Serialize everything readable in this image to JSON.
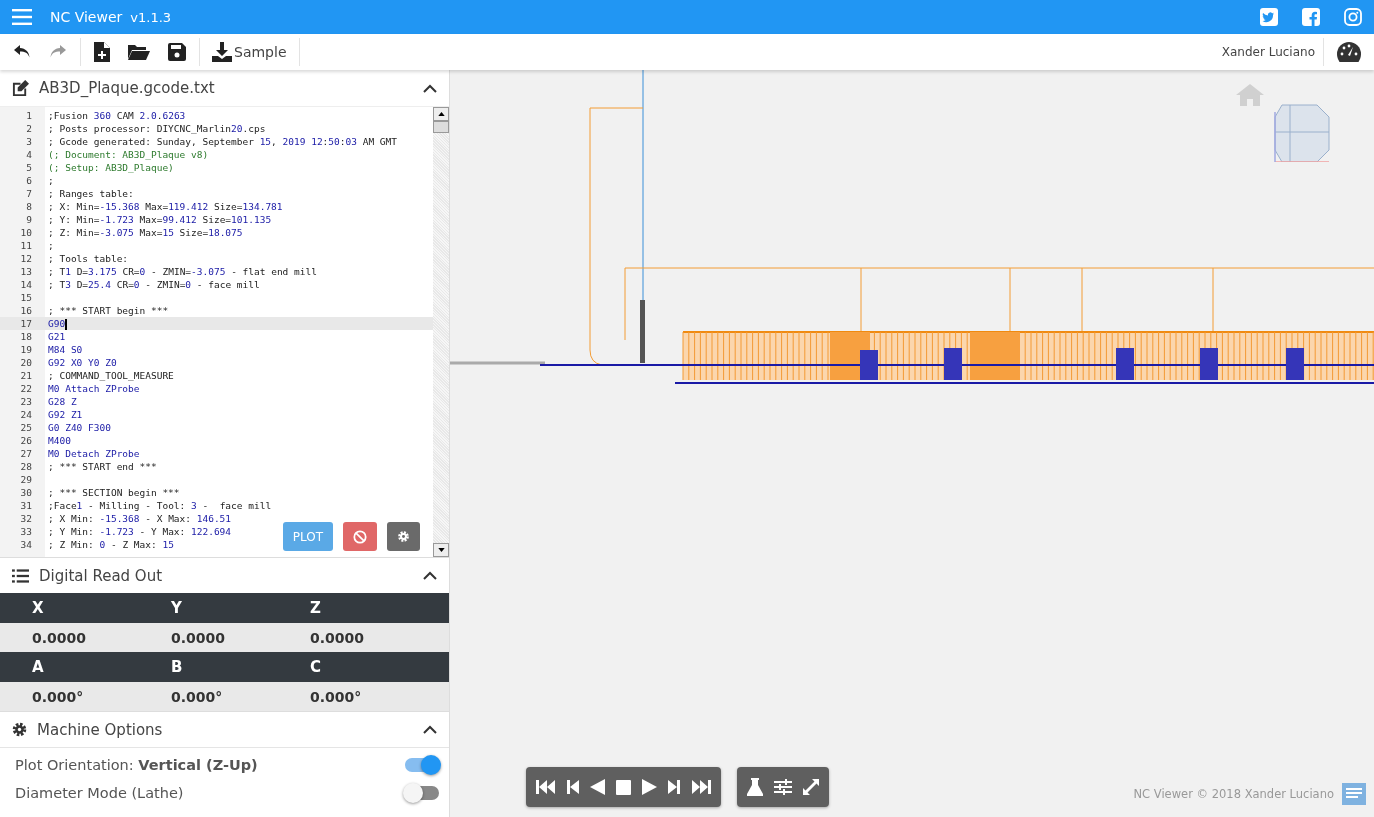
{
  "app": {
    "title": "NC Viewer",
    "version": "v1.1.3"
  },
  "toolbar": {
    "sample_button": "Sample",
    "user": "Xander Luciano"
  },
  "editor": {
    "file_name": "AB3D_Plaque.gcode.txt",
    "lines": [
      {
        "n": "1",
        "text": ";Fusion 360 CAM 2.0.6263",
        "kind": "comment",
        "current": false
      },
      {
        "n": "2",
        "text": "; Posts processor: DIYCNC_Marlin20.cps",
        "kind": "comment",
        "current": false
      },
      {
        "n": "3",
        "text": "; Gcode generated: Sunday, September 15, 2019 12:50:03 AM GMT",
        "kind": "comment",
        "current": false
      },
      {
        "n": "4",
        "text": "(; Document: AB3D_Plaque v8)",
        "kind": "paren",
        "current": false
      },
      {
        "n": "5",
        "text": "(; Setup: AB3D_Plaque)",
        "kind": "paren",
        "current": false
      },
      {
        "n": "6",
        "text": ";",
        "kind": "comment",
        "current": false
      },
      {
        "n": "7",
        "text": "; Ranges table:",
        "kind": "comment",
        "current": false
      },
      {
        "n": "8",
        "text": "; X: Min=-15.368 Max=119.412 Size=134.781",
        "kind": "comment",
        "current": false
      },
      {
        "n": "9",
        "text": "; Y: Min=-1.723 Max=99.412 Size=101.135",
        "kind": "comment",
        "current": false
      },
      {
        "n": "10",
        "text": "; Z: Min=-3.075 Max=15 Size=18.075",
        "kind": "comment",
        "current": false
      },
      {
        "n": "11",
        "text": ";",
        "kind": "comment",
        "current": false
      },
      {
        "n": "12",
        "text": "; Tools table:",
        "kind": "comment",
        "current": false
      },
      {
        "n": "13",
        "text": "; T1 D=3.175 CR=0 - ZMIN=-3.075 - flat end mill",
        "kind": "comment",
        "current": false
      },
      {
        "n": "14",
        "text": "; T3 D=25.4 CR=0 - ZMIN=0 - face mill",
        "kind": "comment",
        "current": false
      },
      {
        "n": "15",
        "current": false
      },
      {
        "n": "16",
        "text": "; *** START begin ***",
        "kind": "comment",
        "current": false
      },
      {
        "n": "17",
        "text": "G90",
        "kind": "code",
        "current": true
      },
      {
        "n": "18",
        "text": "G21",
        "kind": "code",
        "current": false
      },
      {
        "n": "19",
        "text": "M84 S0",
        "kind": "code",
        "current": false
      },
      {
        "n": "20",
        "text": "G92 X0 Y0 Z0",
        "kind": "code",
        "current": false
      },
      {
        "n": "21",
        "text": "; COMMAND_TOOL_MEASURE",
        "kind": "comment",
        "current": false
      },
      {
        "n": "22",
        "text": "M0 Attach ZProbe",
        "kind": "code",
        "current": false
      },
      {
        "n": "23",
        "text": "G28 Z",
        "kind": "code",
        "current": false
      },
      {
        "n": "24",
        "text": "G92 Z1",
        "kind": "code",
        "current": false
      },
      {
        "n": "25",
        "text": "G0 Z40 F300",
        "kind": "code",
        "current": false
      },
      {
        "n": "26",
        "text": "M400",
        "kind": "code",
        "current": false
      },
      {
        "n": "27",
        "text": "M0 Detach ZProbe",
        "kind": "code",
        "current": false
      },
      {
        "n": "28",
        "text": "; *** START end ***",
        "kind": "comment",
        "current": false
      },
      {
        "n": "29",
        "current": false
      },
      {
        "n": "30",
        "text": "; *** SECTION begin ***",
        "kind": "comment",
        "current": false
      },
      {
        "n": "31",
        "text": ";Face1 - Milling - Tool: 3 -  face mill",
        "kind": "comment",
        "current": false
      },
      {
        "n": "32",
        "text": "; X Min: -15.368 - X Max: 146.51",
        "kind": "comment",
        "current": false
      },
      {
        "n": "33",
        "text": "; Y Min: -1.723 - Y Max: 122.694",
        "kind": "comment",
        "current": false
      },
      {
        "n": "34",
        "text": "; Z Min: 0 - Z Max: 15",
        "kind": "comment",
        "current": false
      }
    ],
    "plot_button": "PLOT"
  },
  "dro": {
    "title": "Digital Read Out",
    "rows": [
      {
        "axes": [
          {
            "label": "X",
            "value": "0.0000"
          },
          {
            "label": "Y",
            "value": "0.0000"
          },
          {
            "label": "Z",
            "value": "0.0000"
          }
        ]
      },
      {
        "axes": [
          {
            "label": "A",
            "value": "0.000°"
          },
          {
            "label": "B",
            "value": "0.000°"
          },
          {
            "label": "C",
            "value": "0.000°"
          }
        ]
      }
    ]
  },
  "machine_options": {
    "title": "Machine Options",
    "options": [
      {
        "label": "Plot Orientation: **Vertical (Z-Up)**",
        "on": true
      },
      {
        "label": "Diameter Mode (Lathe)",
        "on": false
      }
    ]
  },
  "footer": "NC Viewer © 2018 Xander Luciano"
}
